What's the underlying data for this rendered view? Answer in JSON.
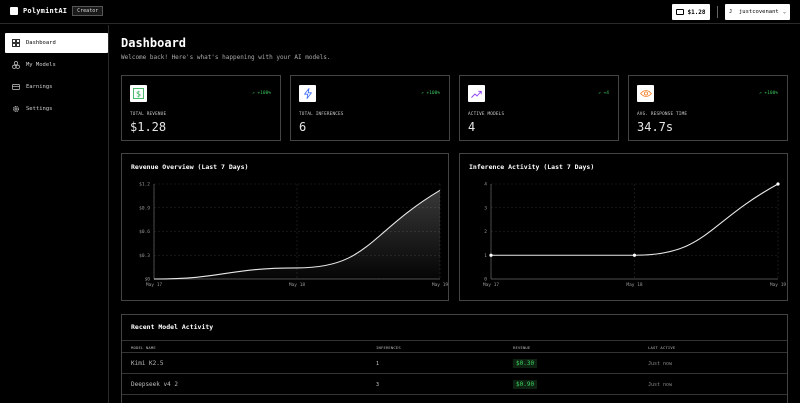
{
  "brand": {
    "name": "PolymintAI",
    "badge": "Creator"
  },
  "topbar": {
    "balance": "$1.28",
    "user_initial": "J",
    "username": "justcovenant",
    "chevron": "⌄"
  },
  "sidebar": {
    "items": [
      {
        "label": "Dashboard",
        "icon": "grid-icon",
        "active": true
      },
      {
        "label": "My Models",
        "icon": "cubes-icon",
        "active": false
      },
      {
        "label": "Earnings",
        "icon": "card-icon",
        "active": false
      },
      {
        "label": "Settings",
        "icon": "gear-icon",
        "active": false
      }
    ]
  },
  "page": {
    "title": "Dashboard",
    "subtitle": "Welcome back! Here's what's happening with your AI models."
  },
  "stats": [
    {
      "label": "TOTAL REVENUE",
      "value": "$1.28",
      "change": "↗ +100%",
      "icon": "dollar-icon",
      "icon_color": "#1fa84a"
    },
    {
      "label": "TOTAL INFERENCES",
      "value": "6",
      "change": "↗ +100%",
      "icon": "lightning-icon",
      "icon_color": "#3b6cf5"
    },
    {
      "label": "ACTIVE MODELS",
      "value": "4",
      "change": "↗ +4",
      "icon": "trend-icon",
      "icon_color": "#8b3bf5"
    },
    {
      "label": "AVG. RESPONSE TIME",
      "value": "34.7s",
      "change": "↗ +100%",
      "icon": "eye-icon",
      "icon_color": "#f57a1f"
    }
  ],
  "charts": {
    "revenue_title": "Revenue Overview (Last 7 Days)",
    "inference_title": "Inference Activity (Last 7 Days)"
  },
  "chart_data": [
    {
      "type": "area",
      "title": "Revenue Overview (Last 7 Days)",
      "x": [
        "May 17",
        "May 18",
        "May 19"
      ],
      "tick_labels_x": [
        "May 17",
        "May 18",
        "May 19"
      ],
      "tick_labels_y": [
        "$0",
        "$0.3",
        "$0.6",
        "$0.9",
        "$1.2"
      ],
      "ylim": [
        0,
        1.2
      ],
      "values": [
        0,
        0.14,
        1.12
      ],
      "grid": true
    },
    {
      "type": "line",
      "title": "Inference Activity (Last 7 Days)",
      "x": [
        "May 17",
        "May 18",
        "May 19"
      ],
      "tick_labels_x": [
        "May 17",
        "May 18",
        "May 19"
      ],
      "tick_labels_y": [
        "0",
        "1",
        "2",
        "3",
        "4"
      ],
      "ylim": [
        0,
        4
      ],
      "values": [
        1,
        1,
        4
      ],
      "grid": true
    }
  ],
  "table": {
    "title": "Recent Model Activity",
    "headers": [
      "MODEL NAME",
      "INFERENCES",
      "REVENUE",
      "LAST ACTIVE"
    ],
    "rows": [
      {
        "name": "Kimi K2.5",
        "inferences": "1",
        "revenue": "$0.30",
        "last_active": "Just now"
      },
      {
        "name": "Deepseek v4 2",
        "inferences": "3",
        "revenue": "$0.90",
        "last_active": "Just now"
      }
    ]
  }
}
